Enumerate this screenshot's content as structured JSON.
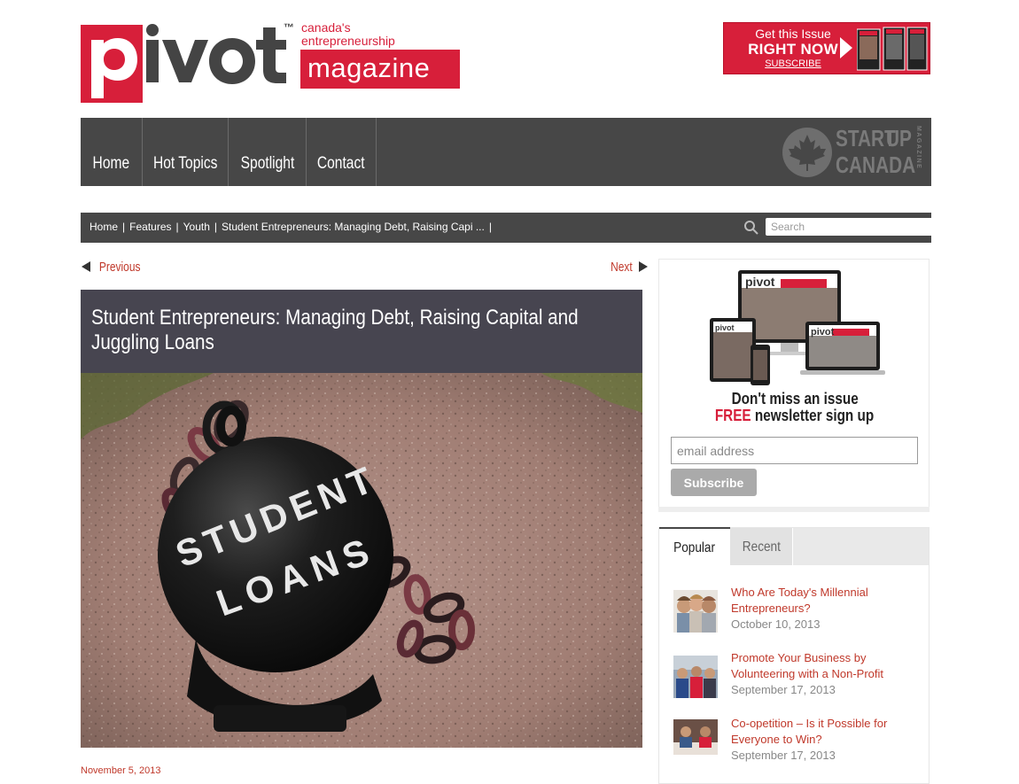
{
  "brand": {
    "logo_word": "pivot",
    "logo_tm": "™",
    "tagline_1": "canada's",
    "tagline_2": "entrepreneurship",
    "logo_magazine": "magazine",
    "red": "#d71f3a",
    "dark": "#474747"
  },
  "promo": {
    "line1": "Get this Issue",
    "line2": "RIGHT NOW",
    "line3": "SUBSCRIBE"
  },
  "nav": {
    "items": [
      "Home",
      "Hot Topics",
      "Spotlight",
      "Contact"
    ],
    "partner_logo": {
      "word1": "START",
      "word2": "UP",
      "word3": "CANADA",
      "side": "MAGAZINE"
    }
  },
  "breadcrumb": {
    "items": [
      "Home",
      "Features",
      "Youth",
      "Student Entrepreneurs: Managing Debt, Raising Capi ..."
    ],
    "search_placeholder": "Search"
  },
  "pager": {
    "previous": "Previous",
    "next": "Next"
  },
  "article": {
    "title": "Student Entrepreneurs: Managing Debt, Raising Capital and Juggling Loans",
    "image_text_1": "STUDENT",
    "image_text_2": "LOANS",
    "date": "November 5, 2013"
  },
  "newsletter": {
    "headline": "Don't miss an issue",
    "free": "FREE",
    "rest": " newsletter sign up",
    "email_placeholder": "email address",
    "button": "Subscribe"
  },
  "tabs": {
    "items": [
      "Popular",
      "Recent"
    ],
    "posts": [
      {
        "title": "Who Are Today's Millennial Entrepreneurs?",
        "date": "October 10, 2013"
      },
      {
        "title": "Promote Your Business by Volunteering with a Non-Profit",
        "date": "September 17, 2013"
      },
      {
        "title": "Co-opetition – Is it Possible for Everyone to Win?",
        "date": "September 17, 2013"
      }
    ]
  }
}
